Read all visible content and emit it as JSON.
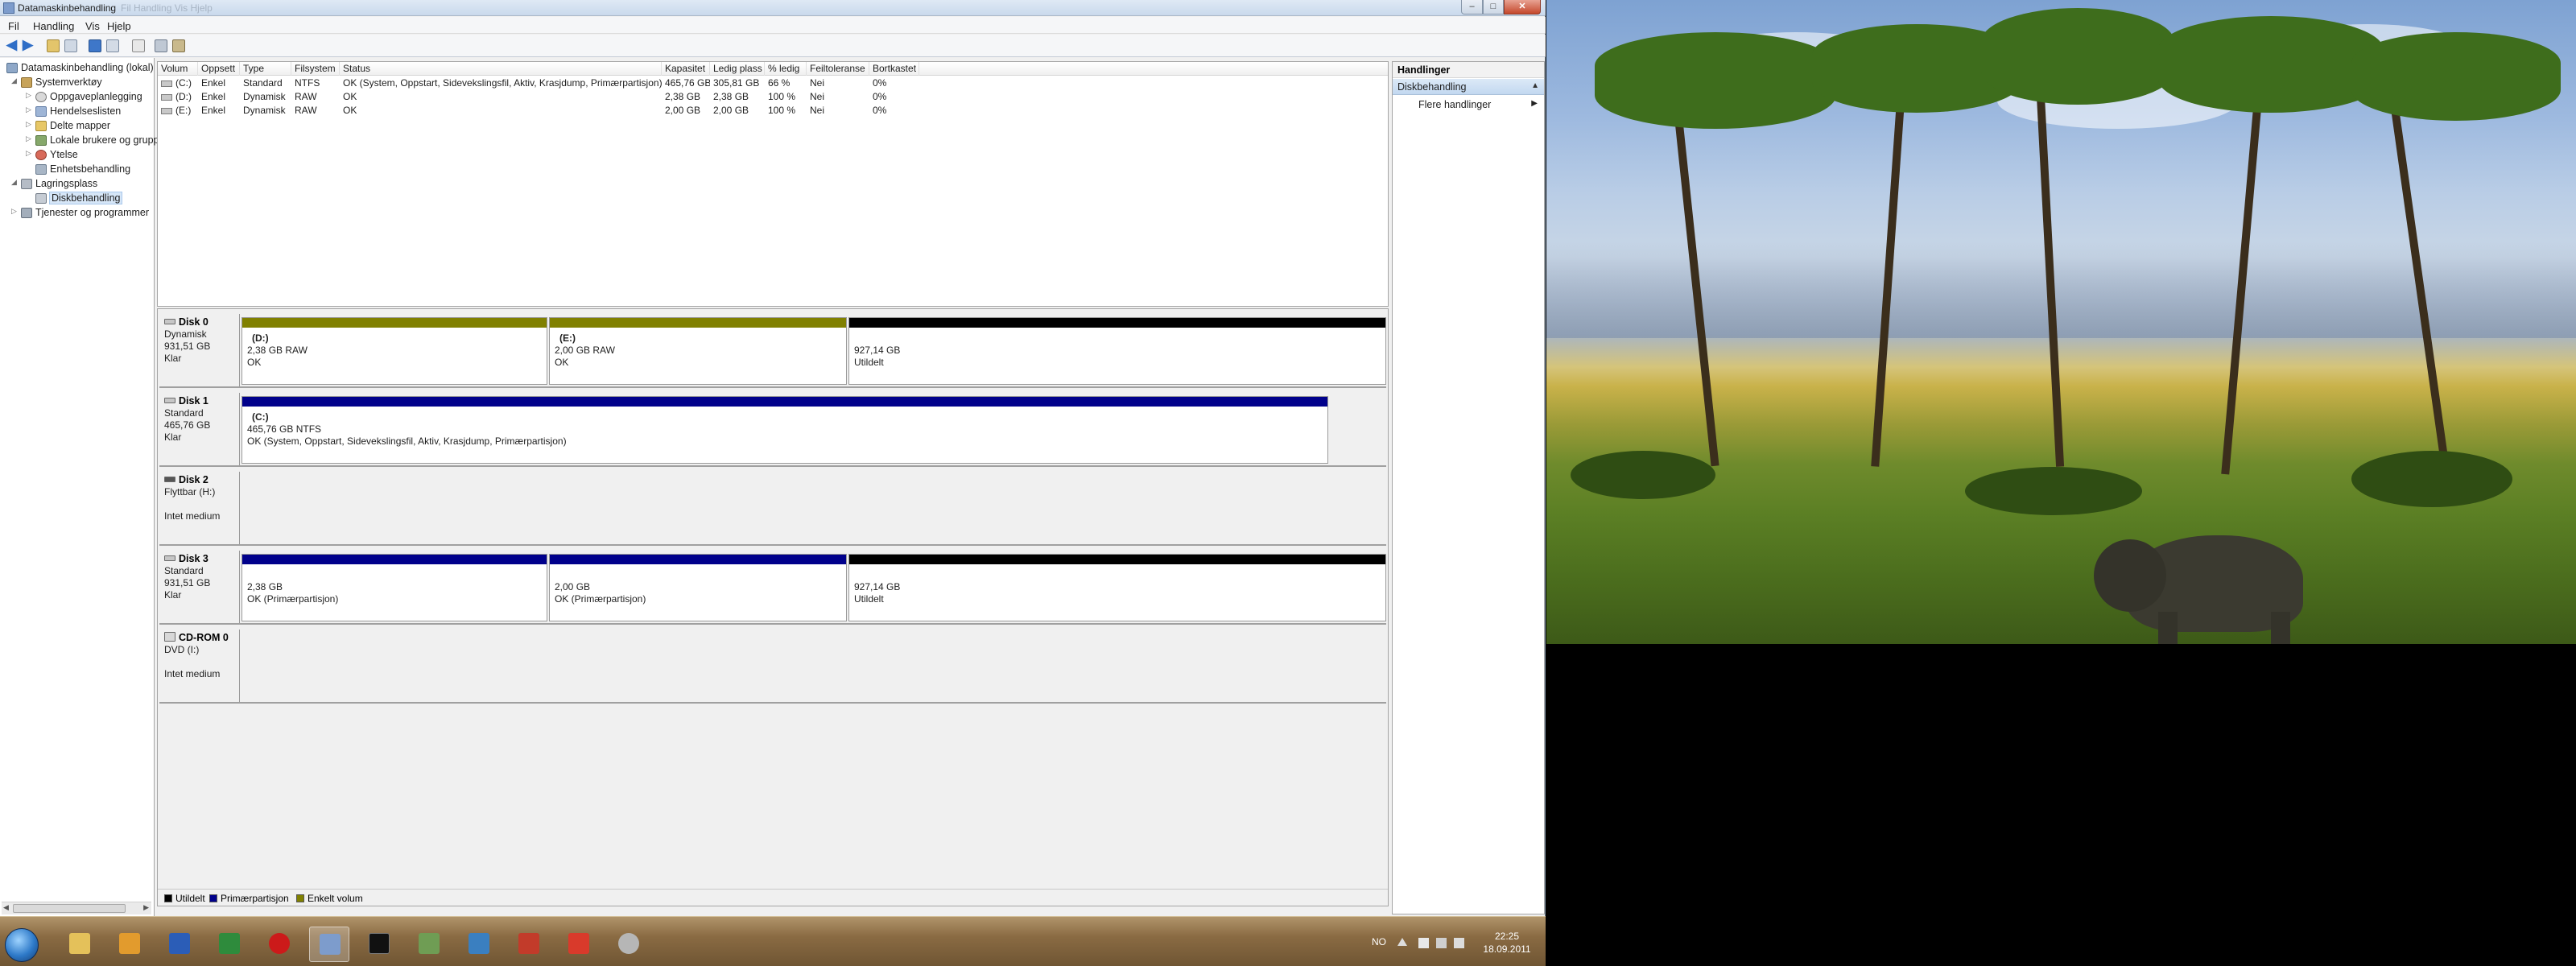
{
  "window": {
    "title": "Datamaskinbehandling",
    "title_ghost": "Fil Handling Vis Hjelp",
    "caption": {
      "minimize": "–",
      "maximize": "□",
      "close": "✕"
    }
  },
  "menu": [
    "Fil",
    "Handling",
    "Vis",
    "Hjelp"
  ],
  "tree": {
    "items": [
      {
        "label": "Datamaskinbehandling (lokal)",
        "icon": "computer-icon"
      },
      {
        "label": "Systemverktøy",
        "icon": "tools-icon"
      },
      {
        "label": "Oppgaveplanlegging",
        "icon": "clock-icon"
      },
      {
        "label": "Hendelseslisten",
        "icon": "event-viewer-icon"
      },
      {
        "label": "Delte mapper",
        "icon": "shared-folder-icon"
      },
      {
        "label": "Lokale brukere og grupp",
        "icon": "users-icon"
      },
      {
        "label": "Ytelse",
        "icon": "performance-icon"
      },
      {
        "label": "Enhetsbehandling",
        "icon": "device-manager-icon"
      },
      {
        "label": "Lagringsplass",
        "icon": "storage-icon"
      },
      {
        "label": "Diskbehandling",
        "icon": "disk-management-icon"
      },
      {
        "label": "Tjenester og programmer",
        "icon": "services-icon"
      }
    ]
  },
  "volume_table": {
    "columns": [
      "Volum",
      "Oppsett",
      "Type",
      "Filsystem",
      "Status",
      "Kapasitet",
      "Ledig plass",
      "% ledig",
      "Feiltoleranse",
      "Bortkastet"
    ],
    "rows": [
      [
        "(C:)",
        "Enkel",
        "Standard",
        "NTFS",
        "OK (System, Oppstart, Sidevekslingsfil, Aktiv, Krasjdump, Primærpartisjon)",
        "465,76 GB",
        "305,81 GB",
        "66 %",
        "Nei",
        "0%"
      ],
      [
        "(D:)",
        "Enkel",
        "Dynamisk",
        "RAW",
        "OK",
        "2,38 GB",
        "2,38 GB",
        "100 %",
        "Nei",
        "0%"
      ],
      [
        "(E:)",
        "Enkel",
        "Dynamisk",
        "RAW",
        "OK",
        "2,00 GB",
        "2,00 GB",
        "100 %",
        "Nei",
        "0%"
      ]
    ]
  },
  "disks": {
    "disk0": {
      "name": "Disk 0",
      "type": "Dynamisk",
      "size": "931,51 GB",
      "state": "Klar",
      "partitions": [
        {
          "title": "(D:)",
          "size": "2,38 GB RAW",
          "status": "OK"
        },
        {
          "title": "(E:)",
          "size": "2,00 GB RAW",
          "status": "OK"
        },
        {
          "title": "",
          "size": "927,14 GB",
          "status": "Utildelt"
        }
      ]
    },
    "disk1": {
      "name": "Disk 1",
      "type": "Standard",
      "size": "465,76 GB",
      "state": "Klar",
      "partitions": [
        {
          "title": "(C:)",
          "size": "465,76 GB NTFS",
          "status": "OK (System, Oppstart, Sidevekslingsfil, Aktiv, Krasjdump, Primærpartisjon)"
        }
      ]
    },
    "disk2": {
      "name": "Disk 2",
      "type": "Flyttbar (H:)",
      "state": "Intet medium"
    },
    "disk3": {
      "name": "Disk 3",
      "type": "Standard",
      "size": "931,51 GB",
      "state": "Klar",
      "partitions": [
        {
          "size": "2,38 GB",
          "status": "OK (Primærpartisjon)"
        },
        {
          "size": "2,00 GB",
          "status": "OK (Primærpartisjon)"
        },
        {
          "size": "927,14 GB",
          "status": "Utildelt"
        }
      ]
    },
    "cdrom0": {
      "name": "CD-ROM 0",
      "type": "DVD (I:)",
      "state": "Intet medium"
    }
  },
  "legend": [
    {
      "label": "Utildelt",
      "color": "#000000"
    },
    {
      "label": "Primærpartisjon",
      "color": "#00008b"
    },
    {
      "label": "Enkelt volum",
      "color": "#808000"
    }
  ],
  "colors": {
    "simple_volume": "#808000",
    "primary": "#00008b",
    "unallocated": "#000000"
  },
  "actions": {
    "header": "Handlinger",
    "section": "Diskbehandling",
    "item": "Flere handlinger",
    "collapse_glyph": "▲",
    "more_glyph": "▶"
  },
  "taskbar": {
    "apps": [
      "explorer-icon",
      "outlook-icon",
      "word-icon",
      "excel-icon",
      "opera-icon",
      "network-icon",
      "cmd-icon",
      "control-panel-icon",
      "remote-desktop-icon",
      "car-game-icon",
      "kaspersky-icon",
      "tools-icon"
    ],
    "language": "NO",
    "time": "22:25",
    "date": "18.09.2011"
  }
}
